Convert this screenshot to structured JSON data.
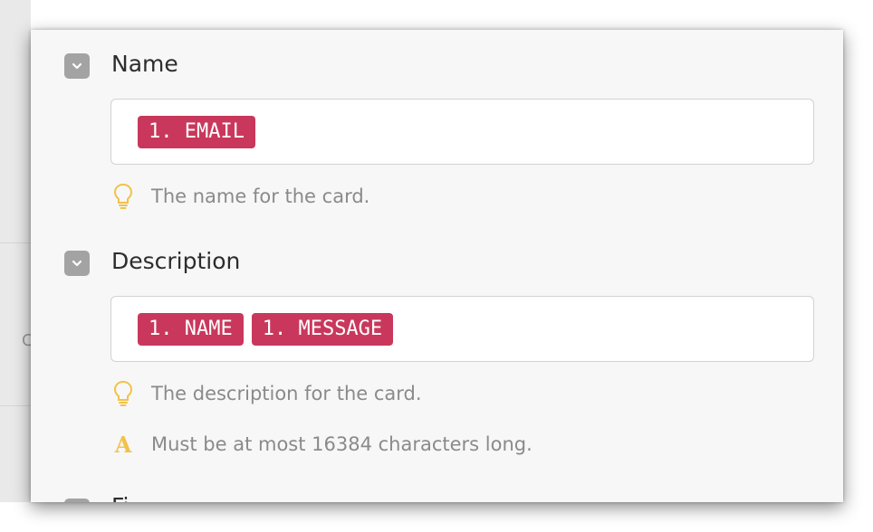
{
  "background_peek_char": "C",
  "fields": [
    {
      "label": "Name",
      "tokens": [
        "1. EMAIL"
      ],
      "hints": [
        {
          "icon": "lightbulb-icon",
          "text": "The name for the card."
        }
      ]
    },
    {
      "label": "Description",
      "tokens": [
        "1. NAME",
        "1. MESSAGE"
      ],
      "hints": [
        {
          "icon": "lightbulb-icon",
          "text": "The description for the card."
        },
        {
          "icon": "text-format-icon",
          "text": "Must be at most 16384 characters long.",
          "glyph": "A"
        }
      ]
    }
  ],
  "next_field_label_partial": "Fi",
  "colors": {
    "token_bg": "#c9385c",
    "hint_icon": "#f2c24a",
    "toggle_bg": "#a3a3a3"
  }
}
